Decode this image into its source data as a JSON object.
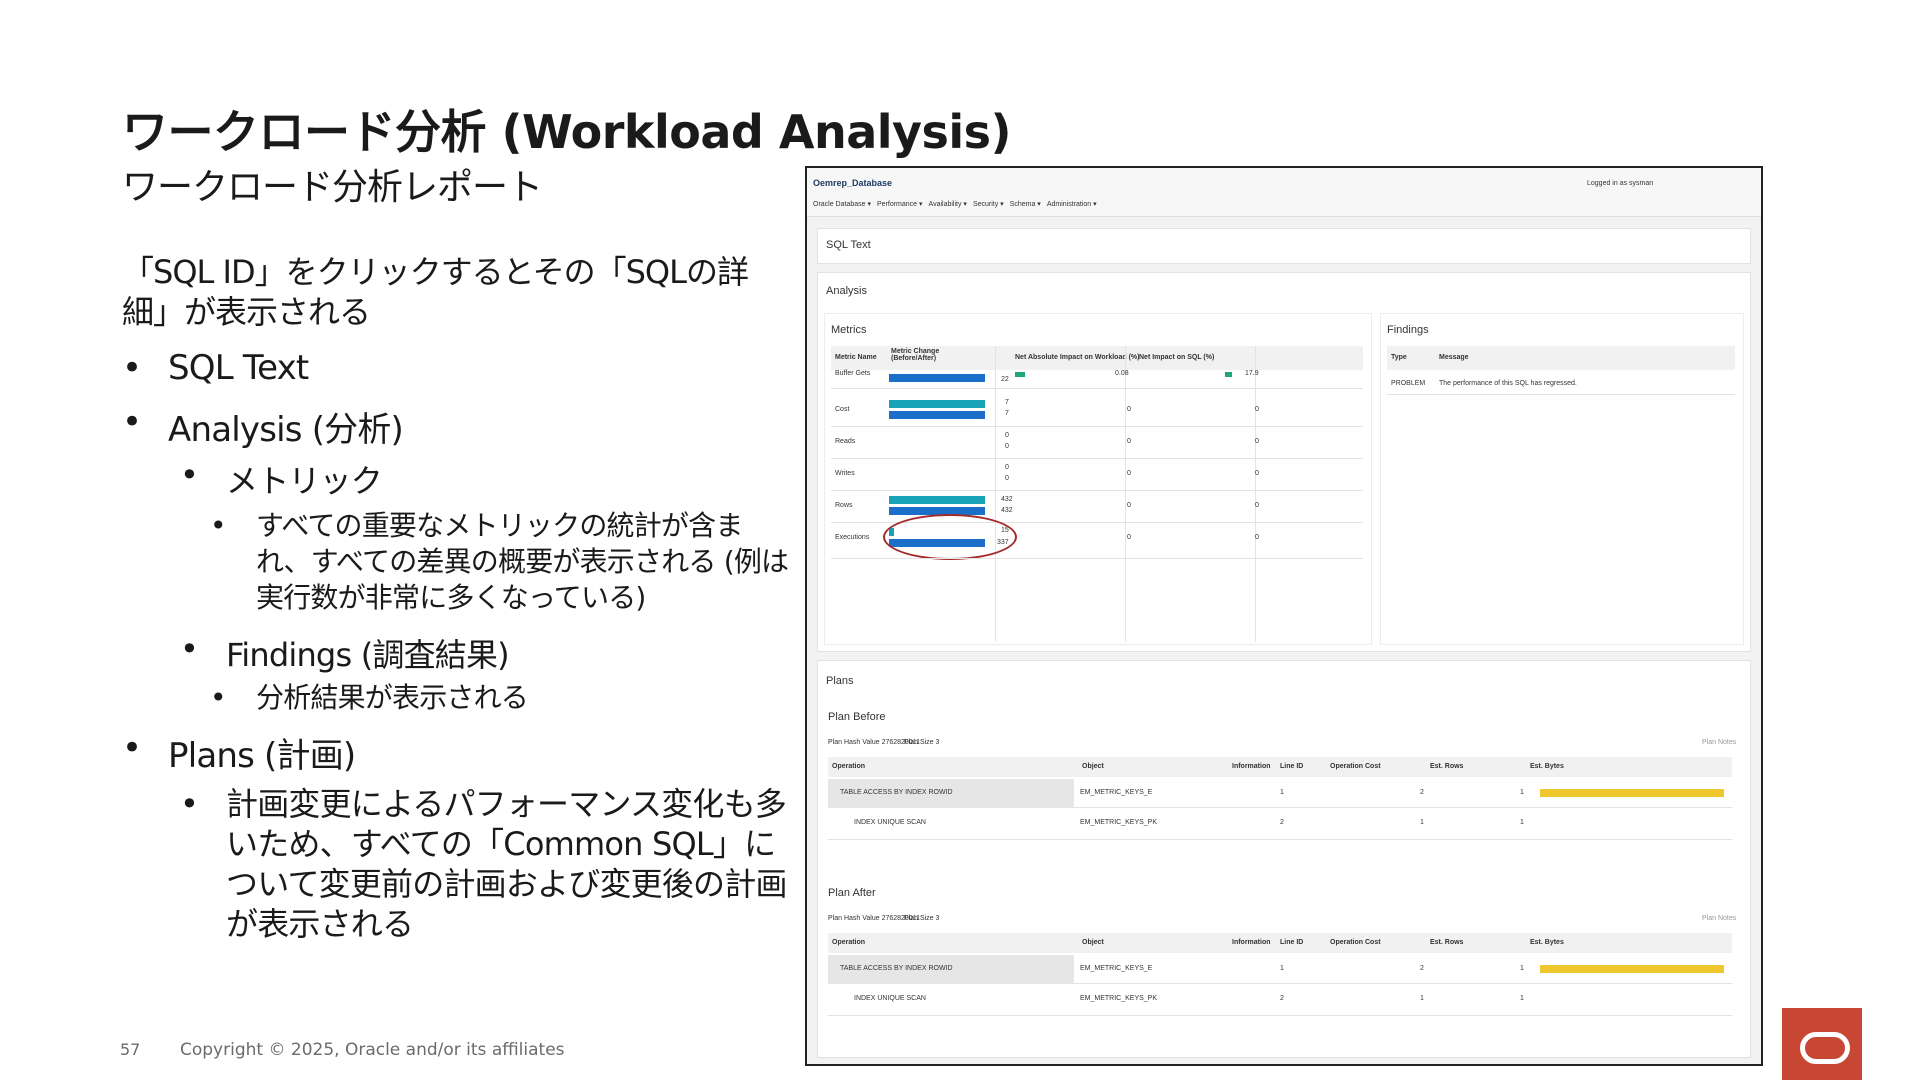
{
  "slide": {
    "title": "ワークロード分析 (Workload Analysis)",
    "subtitle": "ワークロード分析レポート",
    "intro": "「SQL ID」をクリックするとその「SQLの詳細」が表示される",
    "bullets": [
      {
        "text": "SQL Text"
      },
      {
        "text": "Analysis (分析)"
      },
      {
        "text": "メトリック"
      },
      {
        "text": "すべての重要なメトリックの統計が含まれ、すべての差異の概要が表示される (例は実行数が非常に多くなっている)"
      },
      {
        "text": "Findings (調査結果)"
      },
      {
        "text": "分析結果が表示される"
      },
      {
        "text": "Plans (計画)"
      },
      {
        "text": "計画変更によるパフォーマンス変化も多いため、すべての「Common SQL」について変更前の計画および変更後の計画が表示される"
      }
    ],
    "bullet_glyph": "•",
    "page_number": "57",
    "copyright": "Copyright © 2025, Oracle and/or its affiliates",
    "brand_color": "#c74634"
  },
  "app": {
    "db_name": "Oemrep_Database",
    "logged_in": "Logged in as sysman",
    "menu": [
      "Oracle Database ▾",
      "Performance ▾",
      "Availability ▾",
      "Security ▾",
      "Schema ▾",
      "Administration ▾"
    ],
    "sql_text_section": "SQL Text",
    "analysis_section": "Analysis",
    "metrics": {
      "title": "Metrics",
      "headers": [
        "Metric Name",
        "Metric Change (Before/After)",
        "Net Absolute Impact on Workload (%)",
        "Net Impact on SQL (%)"
      ],
      "rows": [
        {
          "name": "Buffer Gets",
          "before": "",
          "after": "22",
          "workload": "0.08",
          "sql": "17.9"
        },
        {
          "name": "Cost",
          "before": "7",
          "after": "7",
          "workload": "0",
          "sql": "0"
        },
        {
          "name": "Reads",
          "before": "0",
          "after": "0",
          "workload": "0",
          "sql": "0"
        },
        {
          "name": "Writes",
          "before": "0",
          "after": "0",
          "workload": "0",
          "sql": "0"
        },
        {
          "name": "Rows",
          "before": "432",
          "after": "432",
          "workload": "0",
          "sql": "0"
        },
        {
          "name": "Executions",
          "before": "15",
          "after": "337",
          "workload": "0",
          "sql": "0"
        }
      ]
    },
    "findings": {
      "title": "Findings",
      "headers": [
        "Type",
        "Message"
      ],
      "rows": [
        {
          "type": "PROBLEM",
          "message": "The performance of this SQL has regressed."
        }
      ]
    },
    "plans": {
      "title": "Plans",
      "columns": [
        "Operation",
        "Object",
        "Information",
        "Line ID",
        "Operation Cost",
        "Est. Rows",
        "Est. Bytes"
      ],
      "plan_notes": "Plan Notes",
      "before": {
        "title": "Plan Before",
        "hash": "Plan Hash Value 2762820011",
        "size": "Plan Size 3",
        "rows": [
          {
            "op": "TABLE ACCESS BY INDEX ROWID",
            "obj": "EM_METRIC_KEYS_E",
            "line": "1",
            "cost": "2",
            "rows": "1"
          },
          {
            "op": "INDEX UNIQUE SCAN",
            "obj": "EM_METRIC_KEYS_PK",
            "line": "2",
            "cost": "1",
            "rows": "1"
          }
        ]
      },
      "after": {
        "title": "Plan After",
        "hash": "Plan Hash Value 2762820011",
        "size": "Plan Size 3",
        "rows": [
          {
            "op": "TABLE ACCESS BY INDEX ROWID",
            "obj": "EM_METRIC_KEYS_E",
            "line": "1",
            "cost": "2",
            "rows": "1"
          },
          {
            "op": "INDEX UNIQUE SCAN",
            "obj": "EM_METRIC_KEYS_PK",
            "line": "2",
            "cost": "1",
            "rows": "1"
          }
        ]
      }
    },
    "colors": {
      "blue_bar": "#1a6fc9",
      "teal_bar": "#17a2b8",
      "yellow_bar": "#eec72f",
      "highlight": "#a52a2a"
    }
  }
}
